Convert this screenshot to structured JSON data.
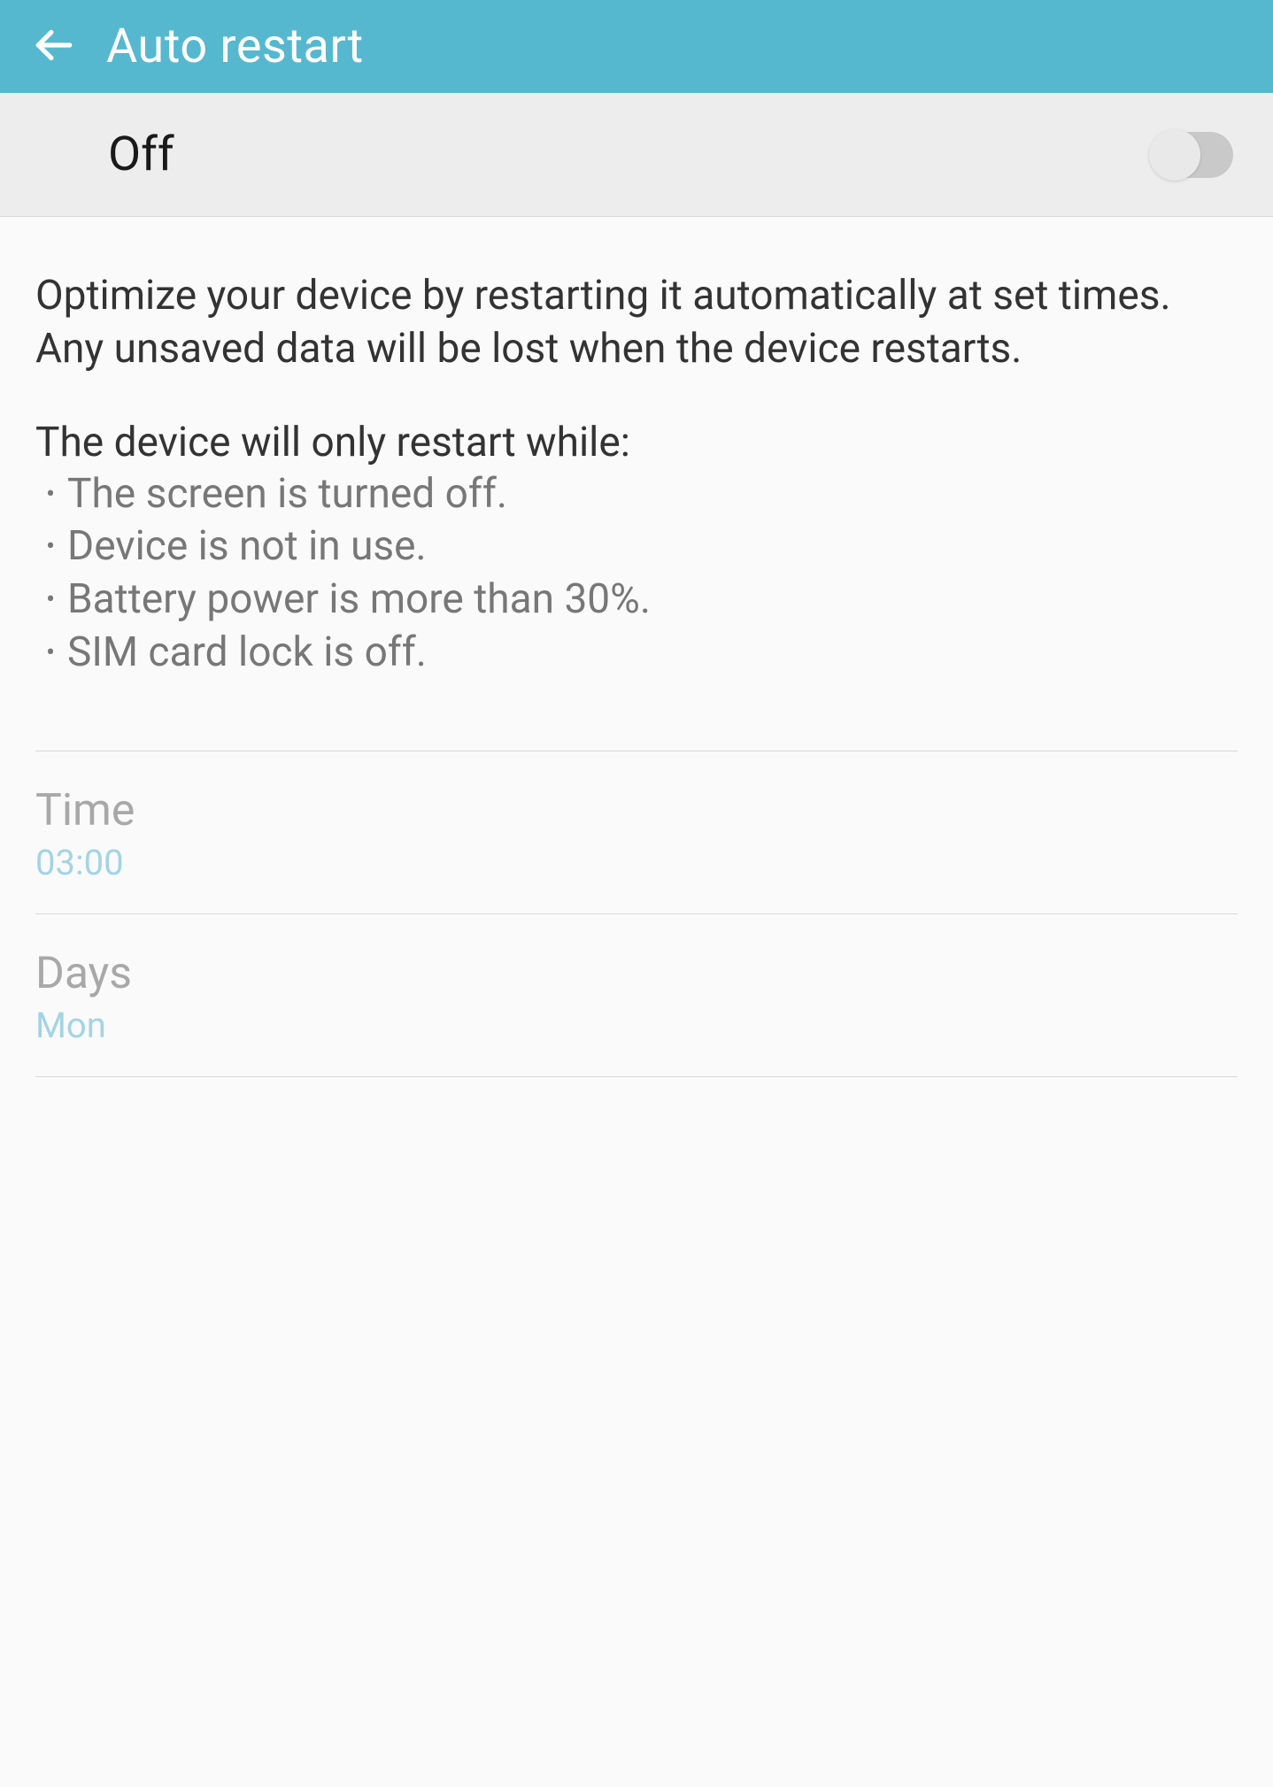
{
  "header": {
    "title": "Auto restart"
  },
  "toggle": {
    "state_label": "Off"
  },
  "description": {
    "text": "Optimize your device by restarting it automatically at set times. Any unsaved data will be lost when the device restarts."
  },
  "conditions": {
    "title": "The device will only restart while:",
    "items": [
      "The screen is turned off.",
      "Device is not in use.",
      "Battery power is more than 30%.",
      "SIM card lock is off."
    ]
  },
  "settings": {
    "time": {
      "label": "Time",
      "value": "03:00"
    },
    "days": {
      "label": "Days",
      "value": "Mon"
    }
  }
}
